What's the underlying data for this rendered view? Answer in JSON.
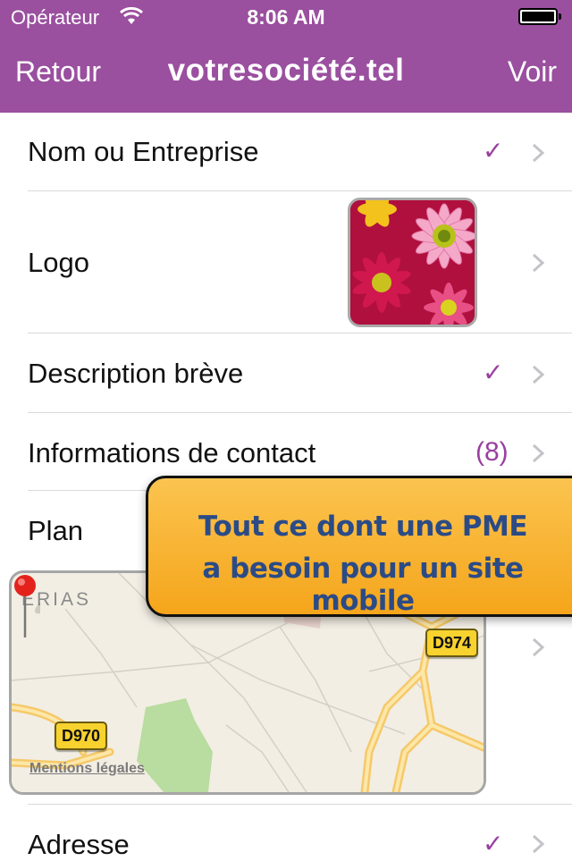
{
  "status": {
    "carrier": "Opérateur",
    "time": "8:06 AM"
  },
  "nav": {
    "back_label": "Retour",
    "title": "votresociété.tel",
    "action_label": "Voir"
  },
  "rows": [
    {
      "label": "Nom ou Entreprise",
      "status": "✓"
    },
    {
      "label": "Logo"
    },
    {
      "label": "Description brève",
      "status": "✓"
    },
    {
      "label": "Informations de contact",
      "status": "(8)"
    },
    {
      "label": "Plan"
    },
    {
      "label": "Adresse",
      "status": "✓"
    }
  ],
  "map": {
    "place_label": "ERIAS",
    "road_labels": [
      "D974",
      "D970"
    ],
    "legal_link": "Mentions légales"
  },
  "banner": {
    "line1": "Tout ce dont une PME",
    "line2": "a besoin pour un site mobile"
  },
  "colors": {
    "accent": "#9a4f9f",
    "banner": "#f7b12c",
    "banner_text": "#2b4b86"
  }
}
